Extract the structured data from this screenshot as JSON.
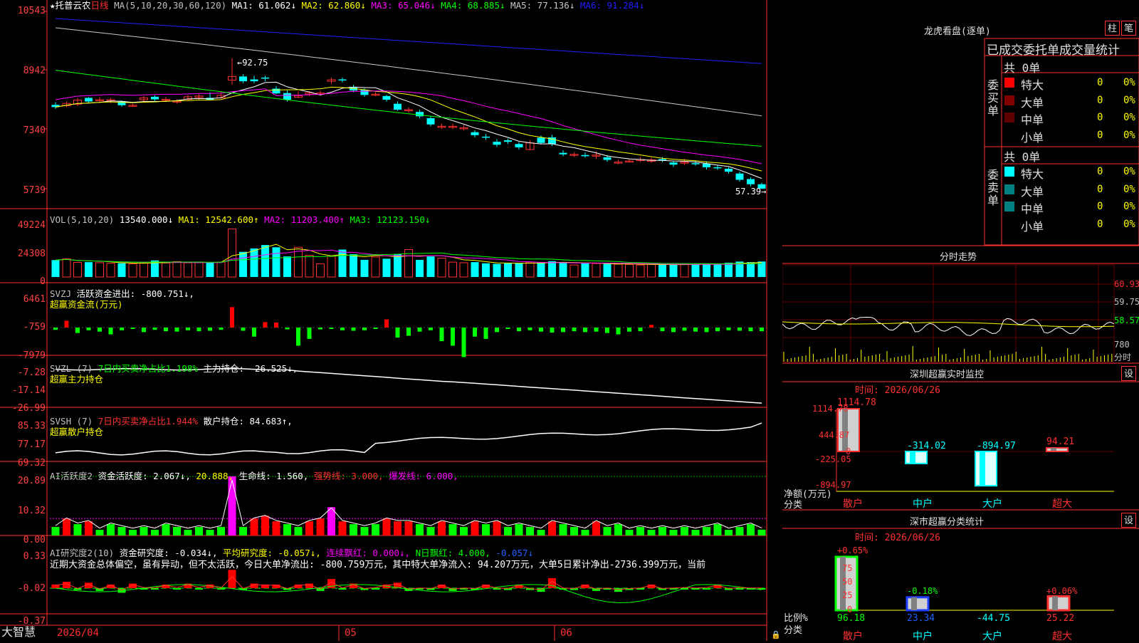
{
  "main": {
    "stock_name": "托普云农",
    "period": "日线",
    "ma_params": "MA(5,10,20,30,60,120)",
    "ma_labels": [
      "MA1: 61.062↓",
      "MA2: 62.860↓",
      "MA3: 65.046↓",
      "MA4: 68.885↓",
      "MA5: 77.136↓",
      "MA6: 91.284↓"
    ],
    "ma_colors": [
      "#ffffff",
      "#ffff00",
      "#ff00ff",
      "#00ff00",
      "#c8c8c8",
      "#2020ff"
    ],
    "y_ticks": [
      "10543",
      "8942",
      "7340",
      "5739"
    ],
    "high_note": "←92.75",
    "low_note": "57.39→"
  },
  "vol": {
    "title": "VOL(5,10,20)",
    "value": "13540.000↓",
    "ma_labels": [
      "MA1: 12542.600↑",
      "MA2: 11203.400↑",
      "MA3: 12123.150↓"
    ],
    "y_ticks": [
      "49224",
      "24308",
      "0"
    ]
  },
  "svzj": {
    "title": "SVZJ",
    "value": "活跃资金进出: -800.751↓,",
    "subtitle": "超赢资金流(万元)",
    "y_ticks": [
      "6461",
      "-759",
      "-7979"
    ]
  },
  "svzl": {
    "title": "SVZL (7)",
    "ratio": "7日内买卖净占比1.198%",
    "value": "主力持仓: -26.525↓,",
    "subtitle": "超赢主力持仓",
    "y_ticks": [
      "-7.28",
      "-17.14",
      "-26.99"
    ]
  },
  "svsh": {
    "title": "SVSH (7)",
    "ratio": "7日内买卖净占比1.944%",
    "value": "散户持仓: 84.683↑,",
    "subtitle": "超赢散户持仓",
    "y_ticks": [
      "85.33",
      "77.17",
      "69.32"
    ]
  },
  "ai1": {
    "title": "AI活跃度2",
    "v1": "资金活跃度: 2.067↓,",
    "v2": "20.888,",
    "v3": "生命线: 1.560,",
    "v4": "强势线: 3.000,",
    "v5": "爆发线: 6.000,",
    "y_ticks": [
      "20.89",
      "10.32",
      "0.00"
    ]
  },
  "ai2": {
    "title": "AI研究度2(10)",
    "v1": "资金研究度: -0.034↓,",
    "v2": "平均研究度: -0.057↓,",
    "v3": "连续飘红: 0.000↓,",
    "v4": "N日飘红: 4.000,",
    "v5": "-0.057↓",
    "comment": "近期大资金总体偏空，虽有异动，但不太活跃，今日大单净流出: -800.759万元，其中特大单净流入: 94.207万元，大单5日累计净出-2736.399万元，当前",
    "y_ticks": [
      "0.33",
      "-0.02",
      "-0.37"
    ]
  },
  "bottom": {
    "brand": "大智慧",
    "date_start": "2026/04",
    "month_5": "05",
    "month_6": "06"
  },
  "lhb": {
    "title": "龙虎看盘(逐单)",
    "btn_zhu": "柱",
    "btn_bi": "笔",
    "header": "已成交委托单成交量统计",
    "buy_total": "共 0单",
    "buy_label": "委买单",
    "sell_total": "共 0单",
    "sell_label": "委卖单",
    "buy_rows": [
      {
        "name": "特大",
        "count": "0",
        "pct": "0%",
        "color": "#ff0000"
      },
      {
        "name": "大单",
        "count": "0",
        "pct": "0%",
        "color": "#800000"
      },
      {
        "name": "中单",
        "count": "0",
        "pct": "0%",
        "color": "#600000"
      },
      {
        "name": "小单",
        "count": "0",
        "pct": "0%",
        "color": ""
      }
    ],
    "sell_rows": [
      {
        "name": "特大",
        "count": "0",
        "pct": "0%",
        "color": "#00ffff"
      },
      {
        "name": "大单",
        "count": "0",
        "pct": "0%",
        "color": "#008080"
      },
      {
        "name": "中单",
        "count": "0",
        "pct": "0%",
        "color": "#008080"
      },
      {
        "name": "小单",
        "count": "0",
        "pct": "0%",
        "color": ""
      }
    ]
  },
  "intraday": {
    "title": "分时走势",
    "y_ticks": [
      "60.93",
      "59.75",
      "58.57",
      "780"
    ],
    "label_fen": "分时"
  },
  "monitor": {
    "title": "深圳超赢实时监控",
    "btn": "设",
    "date": "时间: 2026/06/26",
    "y_ticks": [
      "1114.78",
      "444.87",
      "0",
      "-225.05",
      "-894.97"
    ],
    "unit": "净额(万元)",
    "cat_label": "分类"
  },
  "classstat": {
    "title": "深市超赢分类统计",
    "btn": "设",
    "date": "时间: 2026/06/26",
    "y_ticks": [
      "75",
      "50",
      "25",
      "0"
    ],
    "unit": "比例%",
    "cat_label": "分类"
  },
  "chart_data": [
    {
      "type": "candlestick",
      "title": "托普云农 日线",
      "ylim": [
        5739,
        10543
      ],
      "y_ticks": [
        10543,
        8942,
        7340,
        5739
      ],
      "x_ticks": [
        "2026/04",
        "05",
        "06"
      ],
      "annotations": [
        "←92.75",
        "57.39→"
      ],
      "candles": [
        [
          80.1,
          79.5,
          80.8,
          79.0
        ],
        [
          79.9,
          80.5,
          81.0,
          79.5
        ],
        [
          80.3,
          81.4,
          82.0,
          79.8
        ],
        [
          82.0,
          81.0,
          82.2,
          80.6
        ],
        [
          81.4,
          81.5,
          82.2,
          80.7
        ],
        [
          81.4,
          81.5,
          82.0,
          80.6
        ],
        [
          81.1,
          80.0,
          81.3,
          79.6
        ],
        [
          80.0,
          80.0,
          80.4,
          79.6
        ],
        [
          81.5,
          82.0,
          82.5,
          80.8
        ],
        [
          82.3,
          81.6,
          82.7,
          81.0
        ],
        [
          81.5,
          81.6,
          82.2,
          81.0
        ],
        [
          81.0,
          81.1,
          81.6,
          80.5
        ],
        [
          81.6,
          82.3,
          82.8,
          81.1
        ],
        [
          82.1,
          82.5,
          83.0,
          81.5
        ],
        [
          82.0,
          81.5,
          83.5,
          81.3
        ],
        [
          82.0,
          82.7,
          83.5,
          81.8
        ],
        [
          86.8,
          87.8,
          92.75,
          85.5
        ],
        [
          87.8,
          86.5,
          88.4,
          86.0
        ],
        [
          87.0,
          86.5,
          88.0,
          86.0
        ],
        [
          87.5,
          87.3,
          88.0,
          86.5
        ],
        [
          84.5,
          83.2,
          85.2,
          83.0
        ],
        [
          83.3,
          81.5,
          84.0,
          81.0
        ],
        [
          82.2,
          82.6,
          83.8,
          81.9
        ],
        [
          83.0,
          83.4,
          83.8,
          82.5
        ],
        [
          83.3,
          83.3,
          84.0,
          82.8
        ],
        [
          86.5,
          86.9,
          87.5,
          85.8
        ],
        [
          87.0,
          86.9,
          87.5,
          86.2
        ],
        [
          85.0,
          84.0,
          85.5,
          83.5
        ],
        [
          84.2,
          82.8,
          84.6,
          82.3
        ],
        [
          83.0,
          83.0,
          83.5,
          82.5
        ],
        [
          82.5,
          81.5,
          82.8,
          81.0
        ],
        [
          80.4,
          78.8,
          81.0,
          78.5
        ],
        [
          78.8,
          78.8,
          79.4,
          78.0
        ],
        [
          78.2,
          77.0,
          78.8,
          76.5
        ],
        [
          76.5,
          74.8,
          77.0,
          74.3
        ],
        [
          74.3,
          74.3,
          75.0,
          73.6
        ],
        [
          74.0,
          74.3,
          75.0,
          73.5
        ],
        [
          73.7,
          73.9,
          74.6,
          73.2
        ],
        [
          72.7,
          71.9,
          73.2,
          71.3
        ],
        [
          71.5,
          71.3,
          72.2,
          70.6
        ],
        [
          70.1,
          69.3,
          70.8,
          68.7
        ],
        [
          70.5,
          70.1,
          71.0,
          69.5
        ],
        [
          69.5,
          68.6,
          70.0,
          68.0
        ],
        [
          68.0,
          69.8,
          70.5,
          67.8
        ],
        [
          71.2,
          69.8,
          71.8,
          69.4
        ],
        [
          71.3,
          69.5,
          72.0,
          69.0
        ],
        [
          67.1,
          66.7,
          67.8,
          66.2
        ],
        [
          66.6,
          66.7,
          67.2,
          66.0
        ],
        [
          66.5,
          66.2,
          67.2,
          65.8
        ],
        [
          66.2,
          66.5,
          67.5,
          65.5
        ],
        [
          65.9,
          65.2,
          66.5,
          64.7
        ],
        [
          64.6,
          64.6,
          65.2,
          64.1
        ],
        [
          64.9,
          64.9,
          65.5,
          64.5
        ],
        [
          65.3,
          65.3,
          66.0,
          64.6
        ],
        [
          64.8,
          65.2,
          65.8,
          64.4
        ],
        [
          65.4,
          65.2,
          66.0,
          64.6
        ],
        [
          64.5,
          63.9,
          65.0,
          63.3
        ],
        [
          64.6,
          64.6,
          65.5,
          63.8
        ],
        [
          64.3,
          64.2,
          65.0,
          63.6
        ],
        [
          64.2,
          63.2,
          64.8,
          62.6
        ],
        [
          63.2,
          63.0,
          63.8,
          62.5
        ],
        [
          62.8,
          62.0,
          63.2,
          61.5
        ],
        [
          61.5,
          59.8,
          62.0,
          59.3
        ],
        [
          60.0,
          58.6,
          60.5,
          58.0
        ],
        [
          58.6,
          57.4,
          59.0,
          57.39
        ]
      ],
      "series": [
        {
          "name": "MA1",
          "values": []
        },
        {
          "name": "MA2",
          "values": []
        },
        {
          "name": "MA3",
          "values": []
        },
        {
          "name": "MA4",
          "values": []
        },
        {
          "name": "MA5",
          "values": []
        },
        {
          "name": "MA6",
          "values": []
        }
      ]
    },
    {
      "type": "bar",
      "title": "VOL(5,10,20)",
      "ylim": [
        0,
        49224
      ],
      "y_ticks": [
        49224,
        24308,
        0
      ],
      "values": [
        14800,
        16000,
        12800,
        13000,
        12500,
        12000,
        12000,
        11500,
        12200,
        14500,
        12300,
        13500,
        12400,
        12500,
        12800,
        13000,
        42000,
        22000,
        25000,
        28000,
        26000,
        18000,
        26000,
        19000,
        11500,
        18000,
        24000,
        20000,
        15000,
        17500,
        16000,
        20000,
        24000,
        15000,
        18000,
        16500,
        13000,
        12500,
        13000,
        12000,
        11500,
        12000,
        11800,
        13000,
        12600,
        13800,
        13000,
        10500,
        12000,
        11800,
        11500,
        11200,
        11000,
        10500,
        11000,
        10800,
        11000,
        11000,
        11200,
        11500,
        11200,
        12500,
        13500,
        13000,
        13540
      ]
    },
    {
      "type": "bar",
      "title": "SVZJ 超赢资金流(万元)",
      "ylim": [
        -7979,
        6461
      ],
      "y_ticks": [
        6461,
        -759,
        -7979
      ],
      "values": [
        -500,
        1500,
        -1200,
        -600,
        -900,
        -1500,
        -600,
        -300,
        -1000,
        -500,
        -800,
        -900,
        -600,
        -800,
        -700,
        -500,
        4500,
        -700,
        -2000,
        1200,
        1100,
        -400,
        -4000,
        -2500,
        -400,
        -300,
        -600,
        -700,
        -600,
        -300,
        1800,
        -2200,
        -1800,
        -900,
        -600,
        -3000,
        -4000,
        -6500,
        -2000,
        -2500,
        -1000,
        -300,
        -800,
        -600,
        -900,
        -1100,
        -1000,
        -800,
        -1000,
        -900,
        -1200,
        -1500,
        -900,
        -800,
        600,
        -800,
        -1000,
        -700,
        -900,
        -1000,
        -800,
        -600,
        -700,
        -800,
        -800
      ]
    },
    {
      "type": "line",
      "title": "SVZL (7) 超赢主力持仓",
      "ylim": [
        -26.99,
        -7.28
      ],
      "y_ticks": [
        -7.28,
        -17.14,
        -26.99
      ],
      "values": []
    },
    {
      "type": "line",
      "title": "SVSH (7) 超赢散户持仓",
      "ylim": [
        69.32,
        85.33
      ],
      "y_ticks": [
        85.33,
        77.17,
        69.32
      ],
      "values": []
    },
    {
      "type": "bar",
      "title": "AI活跃度2",
      "ylim": [
        0,
        20.89
      ],
      "y_ticks": [
        20.89,
        10.32,
        0.0
      ],
      "reference_lines": {
        "生命线": 1.56,
        "强势线": 3.0,
        "爆发线": 6.0
      },
      "values": [
        3,
        6,
        4,
        5,
        2,
        4,
        3,
        2,
        3,
        2,
        4,
        3,
        2,
        3,
        2,
        3,
        20.888,
        3,
        6,
        7,
        5,
        4,
        3,
        5,
        6,
        10,
        5,
        4,
        3,
        4,
        6,
        5,
        5,
        4,
        3,
        5,
        4,
        3,
        5,
        4,
        5,
        3,
        4,
        3,
        2,
        5,
        4,
        3,
        2,
        5,
        3,
        4,
        2,
        3,
        2,
        3,
        2,
        3,
        2,
        3,
        4,
        2,
        3,
        4,
        2.067
      ]
    },
    {
      "type": "bar",
      "title": "AI研究度2(10)",
      "ylim": [
        -0.37,
        0.33
      ],
      "y_ticks": [
        0.33,
        -0.02,
        -0.37
      ],
      "values": [
        0.02,
        0.05,
        -0.04,
        0.04,
        -0.05,
        0.02,
        -0.07,
        0.03,
        -0.02,
        -0.03,
        0.02,
        -0.02,
        0.03,
        -0.02,
        0.02,
        -0.03,
        0.18,
        -0.04,
        0.03,
        0.02,
        0.02,
        -0.04,
        0.02,
        0.03,
        -0.05,
        0.08,
        -0.03,
        0.03,
        -0.04,
        -0.02,
        0.02,
        0.04,
        -0.05,
        -0.03,
        -0.04,
        0.02,
        -0.05,
        -0.03,
        -0.04,
        0.02,
        -0.03,
        -0.04,
        0.02,
        -0.04,
        -0.06,
        0.09,
        -0.03,
        -0.04,
        0.02,
        -0.05,
        -0.03,
        -0.06,
        -0.04,
        -0.03,
        0.02,
        -0.04,
        -0.03,
        -0.02,
        -0.03,
        -0.02,
        0.02,
        -0.04,
        -0.02,
        -0.03,
        -0.03
      ]
    },
    {
      "type": "bar",
      "title": "深圳超赢实时监控",
      "categories": [
        "散户",
        "中户",
        "大户",
        "超大"
      ],
      "values": [
        1114.78,
        -314.02,
        -894.97,
        94.21
      ],
      "ylim": [
        -894.97,
        1114.78
      ],
      "y_ticks": [
        1114.78,
        444.87,
        0,
        -225.05,
        -894.97
      ]
    },
    {
      "type": "bar",
      "title": "深市超赢分类统计",
      "categories": [
        "散户",
        "中户",
        "大户",
        "超大"
      ],
      "values": [
        96.18,
        23.34,
        -44.75,
        25.22
      ],
      "bar_changes": [
        "+0.65%",
        "-0.18%",
        "",
        "+0.06%"
      ],
      "ylim": [
        0,
        100
      ],
      "y_ticks": [
        75,
        50,
        25,
        0
      ]
    }
  ]
}
